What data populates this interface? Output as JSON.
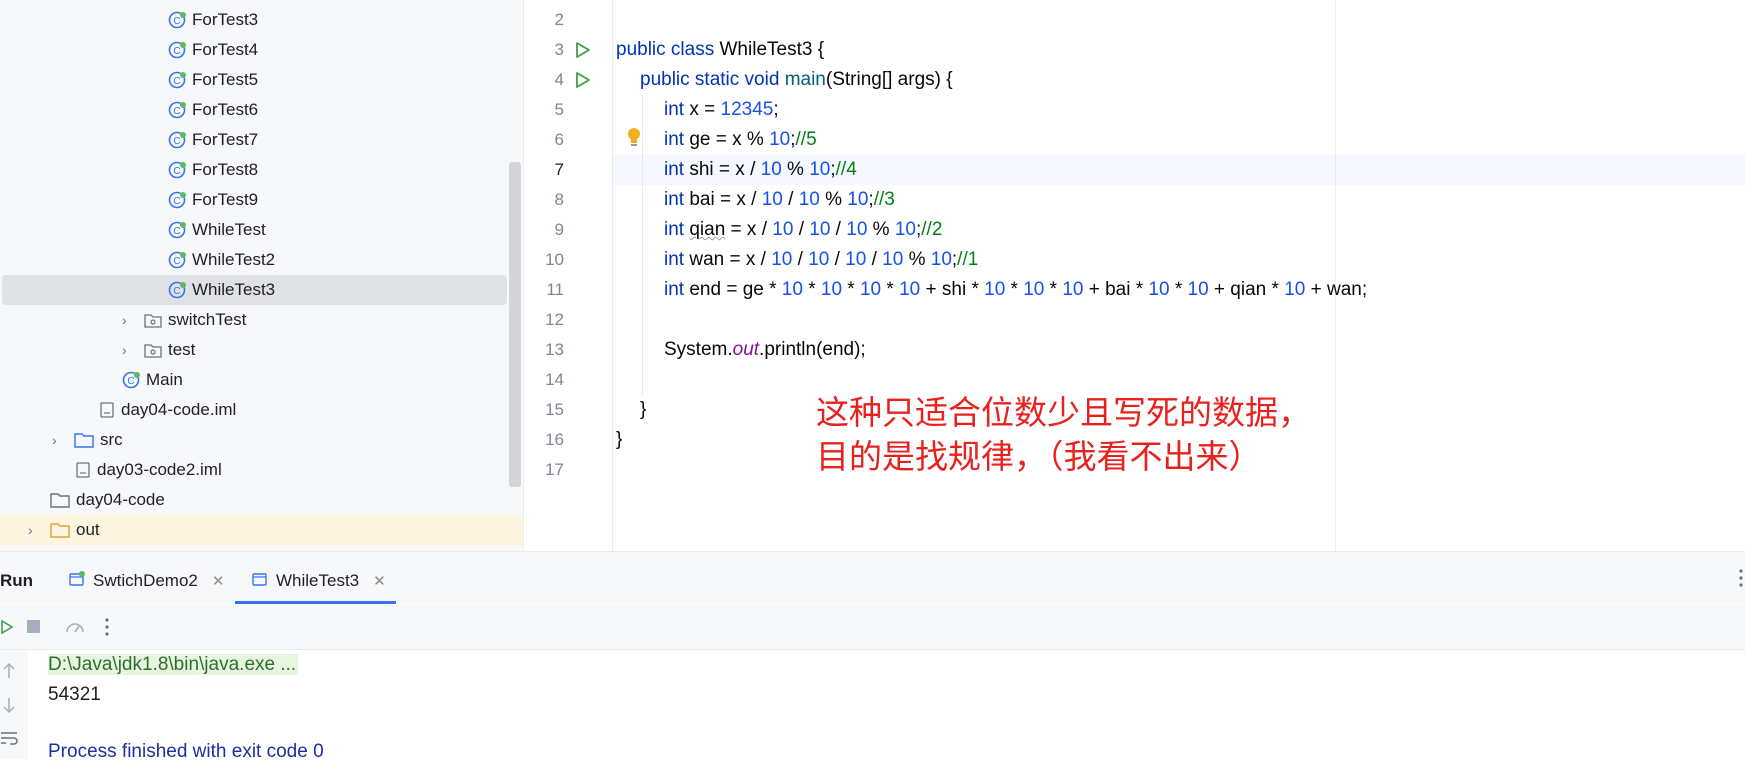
{
  "project_tree": {
    "items": [
      {
        "label": "ForTest3",
        "type": "class"
      },
      {
        "label": "ForTest4",
        "type": "class"
      },
      {
        "label": "ForTest5",
        "type": "class"
      },
      {
        "label": "ForTest6",
        "type": "class"
      },
      {
        "label": "ForTest7",
        "type": "class"
      },
      {
        "label": "ForTest8",
        "type": "class"
      },
      {
        "label": "ForTest9",
        "type": "class"
      },
      {
        "label": "WhileTest",
        "type": "class"
      },
      {
        "label": "WhileTest2",
        "type": "class"
      },
      {
        "label": "WhileTest3",
        "type": "class",
        "selected": true
      },
      {
        "label": "switchTest",
        "type": "package"
      },
      {
        "label": "test",
        "type": "package"
      },
      {
        "label": "Main",
        "type": "class"
      },
      {
        "label": "day04-code.iml",
        "type": "iml"
      },
      {
        "label": "src",
        "type": "folder-blue"
      },
      {
        "label": "day03-code2.iml",
        "type": "iml"
      },
      {
        "label": "day04-code",
        "type": "folder"
      },
      {
        "label": "out",
        "type": "folder-orange"
      }
    ]
  },
  "editor": {
    "line_numbers": [
      "2",
      "3",
      "4",
      "5",
      "6",
      "7",
      "8",
      "9",
      "10",
      "11",
      "12",
      "13",
      "14",
      "15",
      "16",
      "17"
    ],
    "active_line": "7",
    "code": {
      "l3_kw": "public class",
      "l3_rest": " WhileTest3 {",
      "l4_kw": "public static void",
      "l4_fn": "main",
      "l4_rest": "(String[] args) {",
      "l5": [
        "int",
        " x = ",
        "12345",
        ";"
      ],
      "l6": [
        "int",
        " ge = x % ",
        "10",
        ";",
        "//5"
      ],
      "l7": [
        "int",
        " shi = x / ",
        "10",
        " % ",
        "10",
        ";",
        "//4"
      ],
      "l8": [
        "int",
        " bai = x / ",
        "10",
        " / ",
        "10",
        " % ",
        "10",
        ";",
        "//3"
      ],
      "l9": [
        "int",
        " ",
        "qian",
        " = x / ",
        "10",
        " / ",
        "10",
        " / ",
        "10",
        " % ",
        "10",
        ";",
        "//2"
      ],
      "l10": [
        "int",
        " wan = x / ",
        "10",
        " / ",
        "10",
        " / ",
        "10",
        " / ",
        "10",
        " % ",
        "10",
        ";",
        "//1"
      ],
      "l11": [
        "int",
        " end = ge * ",
        "10",
        " * ",
        "10",
        " * ",
        "10",
        " * ",
        "10",
        " + shi * ",
        "10",
        " * ",
        "10",
        " * ",
        "10",
        " + bai * ",
        "10",
        " * ",
        "10",
        " + qian * ",
        "10",
        " + wan;"
      ],
      "l13": [
        "System.",
        "out",
        ".println(end);"
      ],
      "l15": "}",
      "l16": "}"
    },
    "annotation_line1": "这种只适合位数少且写死的数据，",
    "annotation_line2": "目的是找规律，（我看不出来）"
  },
  "run_panel": {
    "title": "Run",
    "tabs": [
      {
        "label": "SwtichDemo2",
        "active": false
      },
      {
        "label": "WhileTest3",
        "active": true
      }
    ],
    "console": {
      "command": "D:\\Java\\jdk1.8\\bin\\java.exe ...",
      "output": "54321",
      "exit": "Process finished with exit code 0"
    }
  },
  "colors": {
    "keyword": "#0033b3",
    "number": "#1750eb",
    "comment": "#067d17",
    "annotation": "#e8211d",
    "accent": "#3574f0"
  }
}
